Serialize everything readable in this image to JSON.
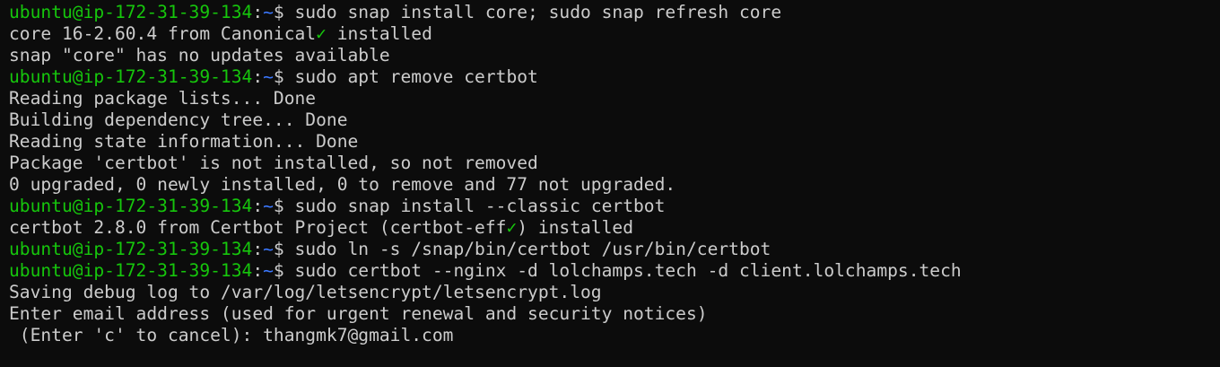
{
  "colors": {
    "background": "#0c0c0c",
    "foreground": "#cccccc",
    "prompt_user": "#16c60c",
    "prompt_path": "#3b78ff",
    "checkmark": "#16c60c"
  },
  "terminal": {
    "lines": [
      {
        "type": "prompt",
        "user": "ubuntu@ip-172-31-39-134",
        "sep": ":",
        "path": "~",
        "sym": "$ ",
        "cmd": "sudo snap install core; sudo snap refresh core"
      },
      {
        "type": "check",
        "pre": "core 16-2.60.4 from Canonical",
        "check": "✓",
        "post": " installed"
      },
      {
        "type": "text",
        "text": "snap \"core\" has no updates available"
      },
      {
        "type": "prompt",
        "user": "ubuntu@ip-172-31-39-134",
        "sep": ":",
        "path": "~",
        "sym": "$ ",
        "cmd": "sudo apt remove certbot"
      },
      {
        "type": "text",
        "text": "Reading package lists... Done"
      },
      {
        "type": "text",
        "text": "Building dependency tree... Done"
      },
      {
        "type": "text",
        "text": "Reading state information... Done"
      },
      {
        "type": "text",
        "text": "Package 'certbot' is not installed, so not removed"
      },
      {
        "type": "text",
        "text": "0 upgraded, 0 newly installed, 0 to remove and 77 not upgraded."
      },
      {
        "type": "prompt",
        "user": "ubuntu@ip-172-31-39-134",
        "sep": ":",
        "path": "~",
        "sym": "$ ",
        "cmd": "sudo snap install --classic certbot"
      },
      {
        "type": "check",
        "pre": "certbot 2.8.0 from Certbot Project (certbot-eff",
        "check": "✓",
        "post": ") installed"
      },
      {
        "type": "prompt",
        "user": "ubuntu@ip-172-31-39-134",
        "sep": ":",
        "path": "~",
        "sym": "$ ",
        "cmd": "sudo ln -s /snap/bin/certbot /usr/bin/certbot"
      },
      {
        "type": "prompt",
        "user": "ubuntu@ip-172-31-39-134",
        "sep": ":",
        "path": "~",
        "sym": "$ ",
        "cmd": "sudo certbot --nginx -d lolchamps.tech -d client.lolchamps.tech"
      },
      {
        "type": "text",
        "text": "Saving debug log to /var/log/letsencrypt/letsencrypt.log"
      },
      {
        "type": "text",
        "text": "Enter email address (used for urgent renewal and security notices)"
      },
      {
        "type": "text",
        "text": " (Enter 'c' to cancel): thangmk7@gmail.com"
      }
    ]
  }
}
